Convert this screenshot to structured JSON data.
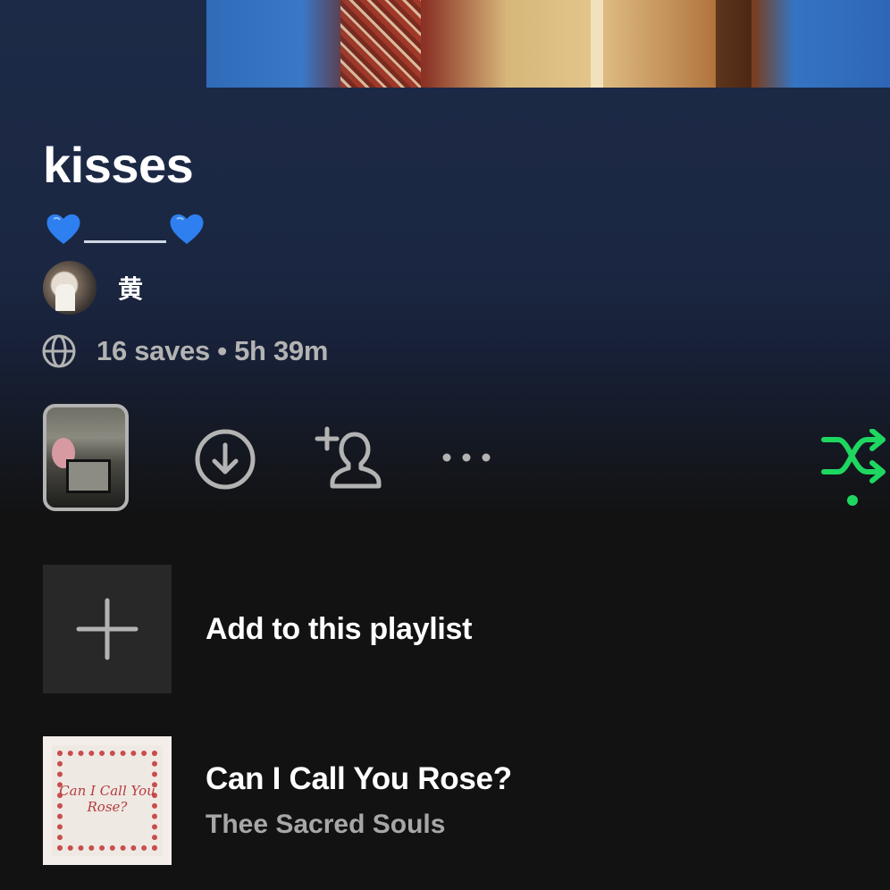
{
  "playlist": {
    "title": "kisses",
    "description_emoji": "💙",
    "owner": "黄",
    "meta": "16 saves • 5h 39m"
  },
  "actions": {
    "icons": [
      "download-icon",
      "add-collaborator-icon",
      "more-icon",
      "shuffle-icon"
    ]
  },
  "add_row": {
    "label": "Add to this playlist"
  },
  "tracks": [
    {
      "title": "Can I Call You Rose?",
      "artist": "Thee Sacred Souls",
      "art_text": "Can I Call You Rose?"
    }
  ],
  "colors": {
    "accent": "#1ed760",
    "heart": "#2e7ff0",
    "muted": "#b3b3b3",
    "background": "#121212"
  }
}
